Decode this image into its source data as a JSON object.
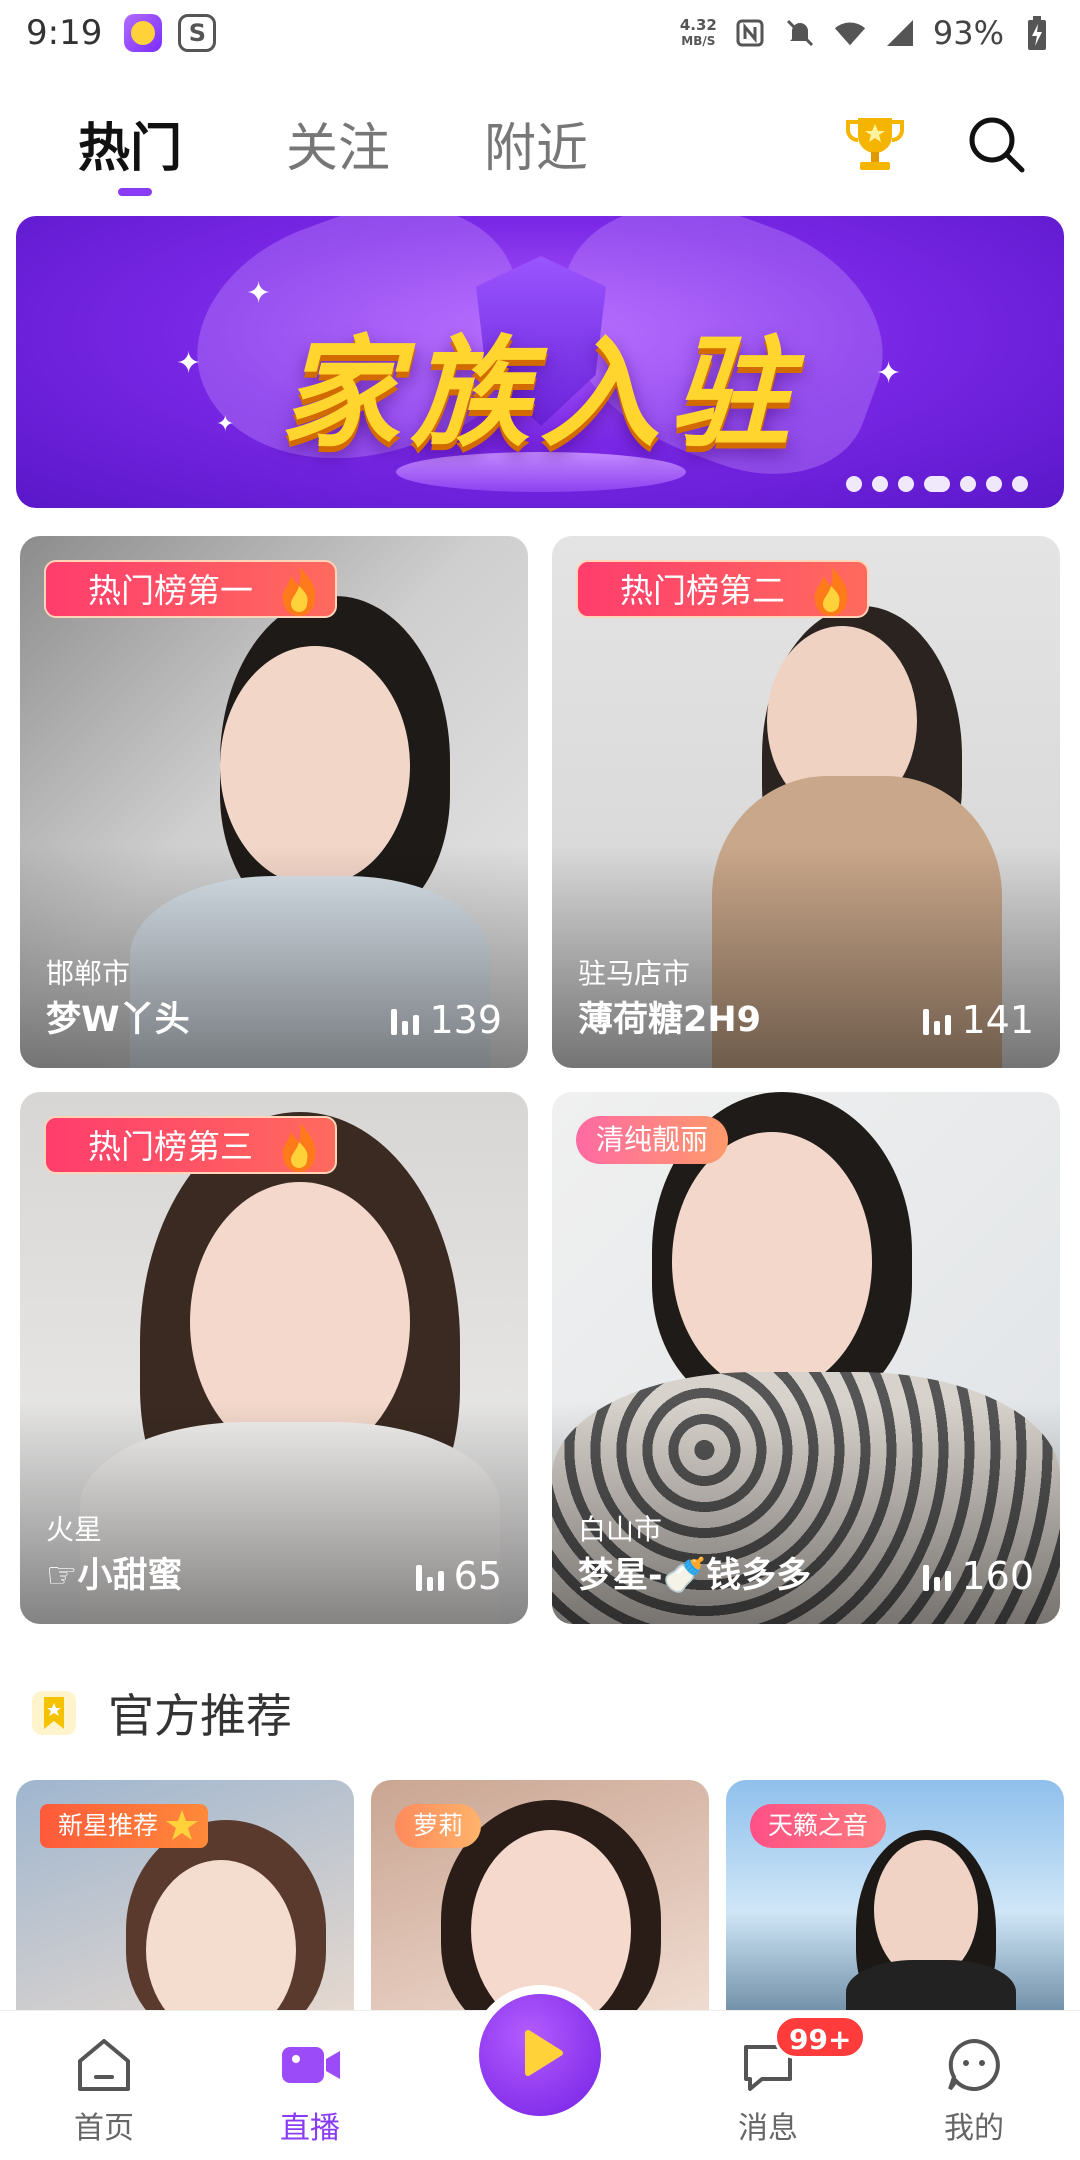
{
  "status_bar": {
    "time": "9:19",
    "net_speed_value": "4.32",
    "net_speed_unit": "MB/S",
    "battery_percent": "93%"
  },
  "top_tabs": [
    "热门",
    "关注",
    "附近"
  ],
  "active_tab": "热门",
  "banner": {
    "title": "家族入驻",
    "slide_count": 7,
    "active_slide_index": 3
  },
  "live_cards": [
    {
      "badge": "热门榜第一",
      "city": "邯郸市",
      "name": "梦W丫头",
      "viewers": "139"
    },
    {
      "badge": "热门榜第二",
      "city": "驻马店市",
      "name": "薄荷糖2H9",
      "viewers": "141"
    },
    {
      "badge": "热门榜第三",
      "city": "火星",
      "name": "☞小甜蜜",
      "viewers": "65"
    },
    {
      "tag": "清纯靓丽",
      "city": "白山市",
      "name": "梦星-🍼钱多多",
      "viewers": "160"
    }
  ],
  "official": {
    "title": "官方推荐",
    "cards": [
      {
        "tag": "新星推荐"
      },
      {
        "tag": "萝莉"
      },
      {
        "tag": "天籁之音"
      }
    ]
  },
  "bottom_nav": {
    "home": "首页",
    "live": "直播",
    "messages": "消息",
    "messages_badge": "99+",
    "profile": "我的"
  },
  "colors": {
    "accent": "#8a3cf5",
    "badge_red": "#ff3d6c",
    "banner_gold": "#ffd52e"
  }
}
